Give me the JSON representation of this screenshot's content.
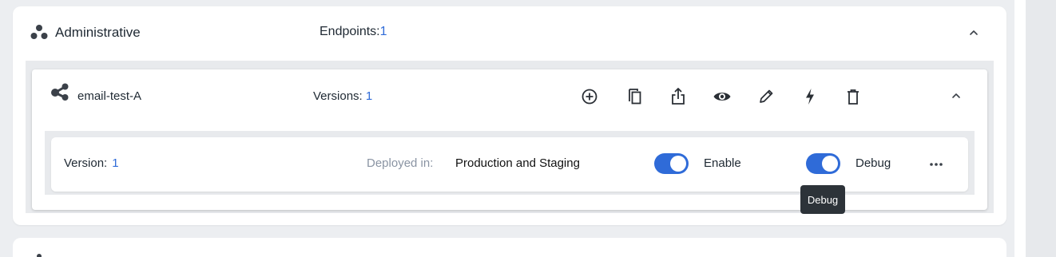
{
  "group": {
    "title": "Administrative",
    "endpoints_label": "Endpoints:",
    "endpoints_count": "1"
  },
  "endpoint": {
    "title": "email-test-A",
    "versions_label": "Versions:",
    "versions_count": "1",
    "tools": [
      "add-icon",
      "copy-icon",
      "share-icon",
      "view-icon",
      "edit-icon",
      "bolt-icon",
      "delete-icon"
    ]
  },
  "version": {
    "label": "Version:",
    "number": "1",
    "deployed_label": "Deployed in:",
    "deployed_value": "Production and Staging",
    "enable_label": "Enable",
    "enable_on": true,
    "debug_label": "Debug",
    "debug_on": true
  },
  "tooltip": {
    "text": "Debug"
  },
  "colors": {
    "accent": "#2f6bd8",
    "toggle_on": "#2f6bd8",
    "tooltip_bg": "#2d3339"
  }
}
